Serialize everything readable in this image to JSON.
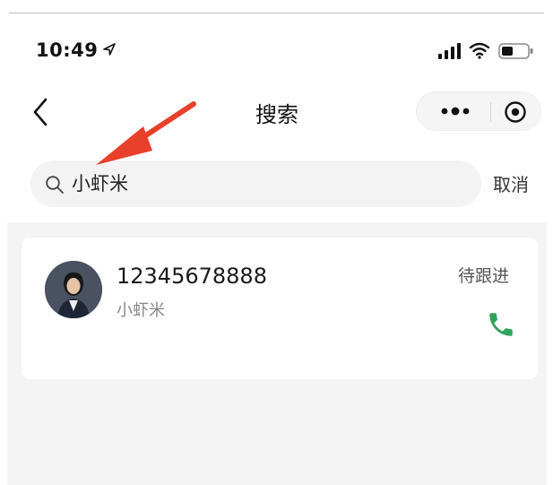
{
  "status_bar": {
    "time": "10:49",
    "icons": [
      "location-arrow-icon",
      "cellular-signal-icon",
      "wifi-icon",
      "battery-icon"
    ]
  },
  "nav": {
    "title": "搜索",
    "back_icon": "chevron-left-icon",
    "menu_icons": [
      "more-dots-icon",
      "close-circle-icon"
    ]
  },
  "search": {
    "value": "小虾米",
    "placeholder": "",
    "cancel_label": "取消",
    "icon": "search-icon"
  },
  "results": [
    {
      "phone": "12345678888",
      "name": "小虾米",
      "status": "待跟进",
      "action_icon": "phone-icon"
    }
  ],
  "colors": {
    "accent_green": "#2fa35a",
    "annotation_red": "#e8402b",
    "list_background": "#f4f4f4"
  }
}
